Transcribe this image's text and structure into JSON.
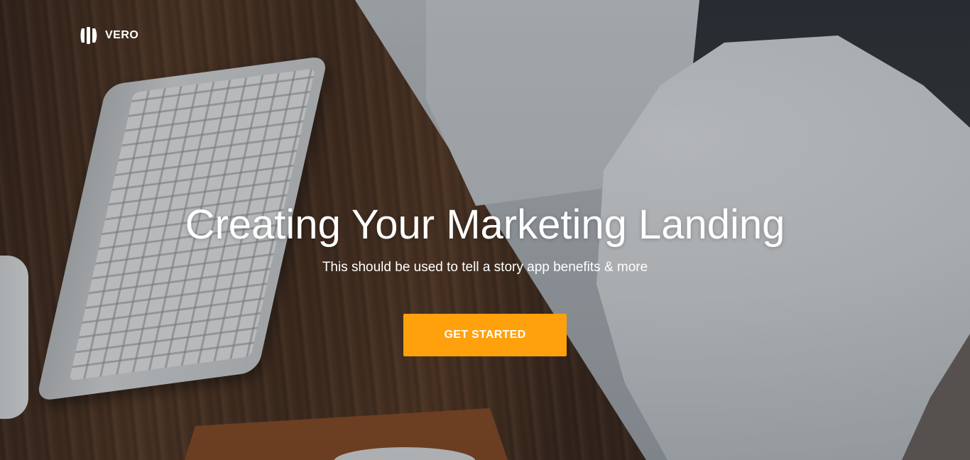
{
  "brand": {
    "name": "VERO",
    "logo_icon": "vero-logo-icon"
  },
  "hero": {
    "headline": "Creating Your Marketing Landing",
    "subtitle": "This should be used to tell a story app benefits & more",
    "background": "desk-keyboard-chair-photo"
  },
  "cta": {
    "label": "GET STARTED",
    "color": "#ffa10d"
  }
}
